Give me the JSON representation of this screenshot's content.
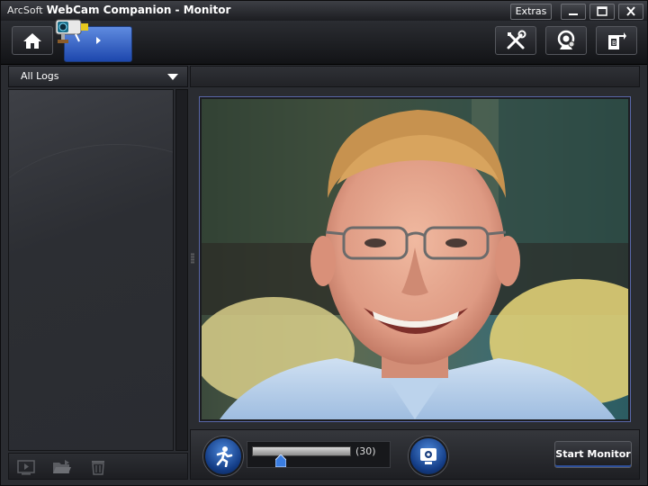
{
  "titlebar": {
    "brand": "ArcSoft",
    "app_title": "WebCam Companion - Monitor",
    "extras_label": "Extras"
  },
  "toolbar": {
    "buttons": [
      "home-icon",
      "monitor-camera-icon",
      "tools-icon",
      "webcam-settings-icon",
      "export-icon"
    ]
  },
  "left_panel": {
    "filter_selected": "All Logs",
    "bottom_buttons": [
      "play-log-icon",
      "open-folder-icon",
      "trash-icon"
    ]
  },
  "monitor": {
    "sensitivity_value": 30,
    "sensitivity_display": "(30)",
    "start_label": "Start Monitor"
  },
  "colors": {
    "accent_blue": "#1d47ad",
    "panel": "#2a2c31",
    "frame_border": "#5967a8"
  }
}
